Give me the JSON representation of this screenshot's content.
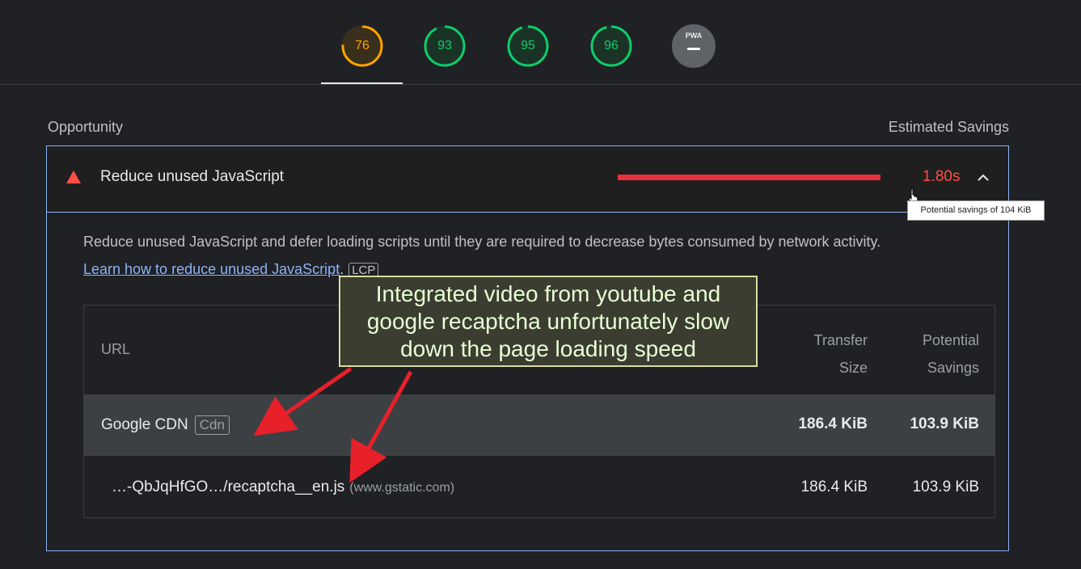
{
  "scores": [
    {
      "value": "76",
      "color": "#ffa400",
      "fraction": 0.76
    },
    {
      "value": "93",
      "color": "#0cce6b",
      "fraction": 0.93
    },
    {
      "value": "95",
      "color": "#0cce6b",
      "fraction": 0.95
    },
    {
      "value": "96",
      "color": "#0cce6b",
      "fraction": 0.96
    }
  ],
  "pwa": {
    "label": "PWA",
    "icon": "dash-icon"
  },
  "section": {
    "left": "Opportunity",
    "right": "Estimated Savings"
  },
  "audit": {
    "title": "Reduce unused JavaScript",
    "savings": "1.80s",
    "severity_color": "#ff4e42",
    "tooltip": "Potential savings of 104 KiB",
    "description": "Reduce unused JavaScript and defer loading scripts until they are required to decrease bytes consumed by network activity.",
    "learn_link": "Learn how to reduce unused JavaScript",
    "period": ".",
    "badge": "LCP"
  },
  "table": {
    "headers": {
      "url": "URL",
      "transfer_1": "Transfer",
      "transfer_2": "Size",
      "potential_1": "Potential",
      "potential_2": "Savings"
    },
    "group": {
      "name": "Google CDN",
      "badge": "Cdn",
      "transfer": "186.4 KiB",
      "potential": "103.9 KiB"
    },
    "row": {
      "file": "…-QbJqHfGO…/recaptcha__en.js",
      "host": "(www.gstatic.com)",
      "transfer": "186.4 KiB",
      "potential": "103.9 KiB"
    }
  },
  "annotation": {
    "line1": "Integrated video from youtube and",
    "line2": "google recaptcha unfortunately slow",
    "line3": "down the page loading speed"
  }
}
